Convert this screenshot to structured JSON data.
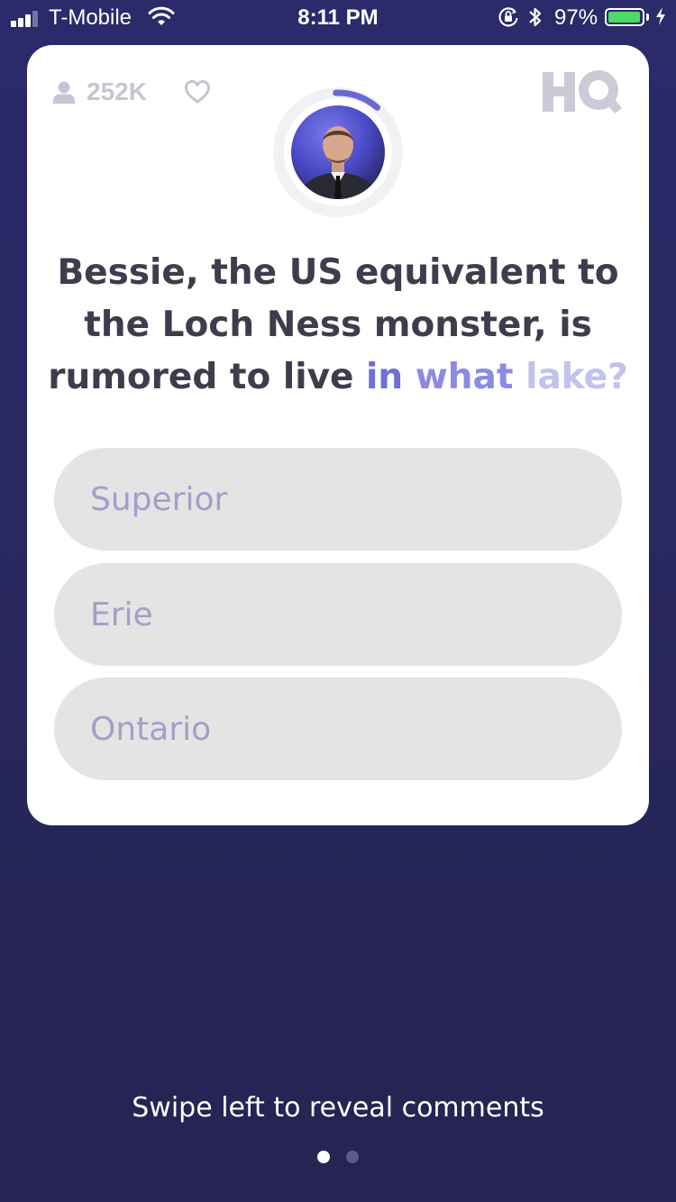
{
  "status_bar": {
    "carrier": "T-Mobile",
    "time": "8:11 PM",
    "battery_percent": "97%",
    "battery_level": 0.97,
    "icons": [
      "signal-icon",
      "wifi-icon",
      "rotation-lock-icon",
      "bluetooth-icon",
      "battery-icon",
      "charging-icon"
    ]
  },
  "game": {
    "viewer_count": "252K",
    "logo": "HQ",
    "timer_progress": 0.12,
    "question": {
      "parts": [
        "Bessie, the US equivalent to the Loch Ness monster, is rumored to live",
        "in",
        "what",
        "lake?"
      ]
    },
    "answers": [
      "Superior",
      "Erie",
      "Ontario"
    ]
  },
  "footer": {
    "hint": "Swipe left to reveal comments",
    "pages": 2,
    "current_page": 1
  },
  "colors": {
    "accent": "#6f6fd6",
    "answer_bg": "#e4e4e4",
    "answer_text": "#a29fc8",
    "background": "#2a2862"
  }
}
